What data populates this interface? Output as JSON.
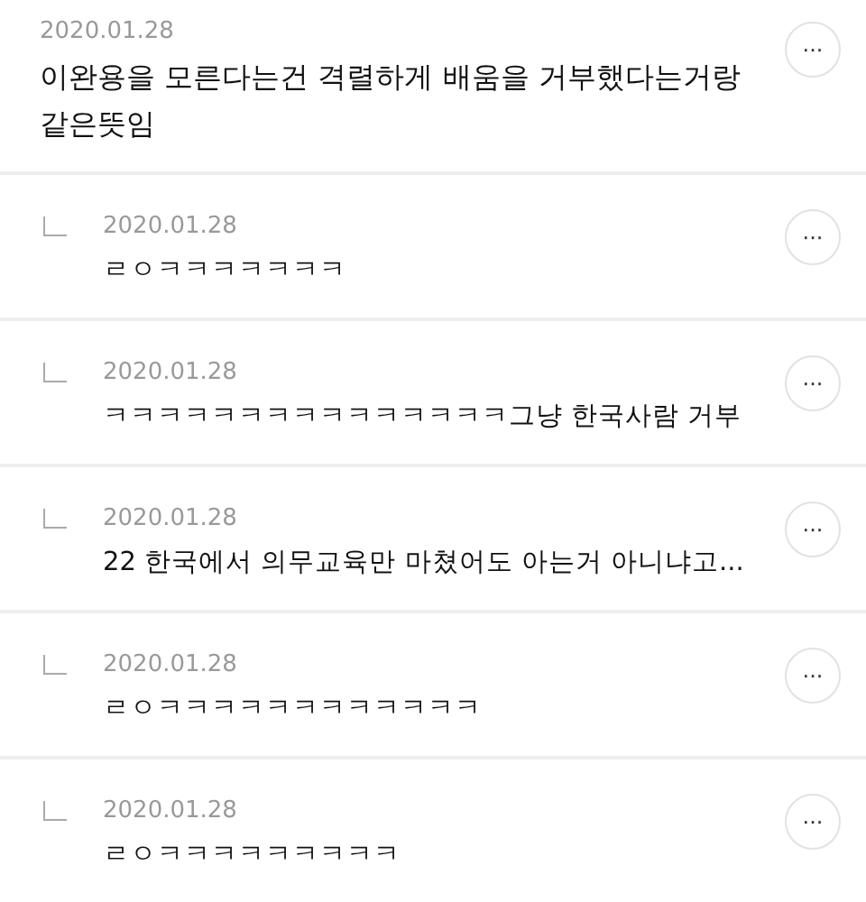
{
  "comments": [
    {
      "kind": "comment",
      "date": "2020.01.28",
      "text": "이완용을 모른다는건 격렬하게 배움을 거부했다는거랑 같은뜻임",
      "menu": "···"
    },
    {
      "kind": "reply",
      "date": "2020.01.28",
      "text": "ㄹㅇㅋㅋㅋㅋㅋㅋㅋ",
      "menu": "···"
    },
    {
      "kind": "reply",
      "date": "2020.01.28",
      "text": "ㅋㅋㅋㅋㅋㅋㅋㅋㅋㅋㅋㅋㅋㅋㅋ그냥 한국사람 거부",
      "menu": "···"
    },
    {
      "kind": "reply",
      "date": "2020.01.28",
      "text": "22 한국에서 의무교육만 마쳤어도 아는거 아니냐고...",
      "menu": "···"
    },
    {
      "kind": "reply",
      "date": "2020.01.28",
      "text": "ㄹㅇㅋㅋㅋㅋㅋㅋㅋㅋㅋㅋㅋㅋ",
      "menu": "···"
    },
    {
      "kind": "reply",
      "date": "2020.01.28",
      "text": "ㄹㅇㅋㅋㅋㅋㅋㅋㅋㅋㅋ",
      "menu": "···"
    }
  ]
}
